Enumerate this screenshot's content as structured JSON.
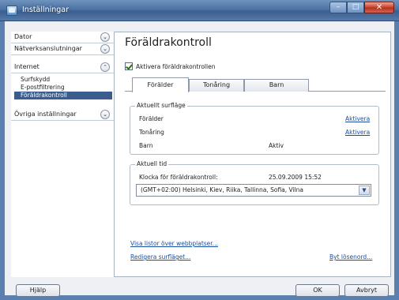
{
  "window": {
    "title": "Inställningar",
    "min": "–",
    "max": "□",
    "close": "✕"
  },
  "sidebar": {
    "categories": [
      {
        "label": "Dator",
        "chev": "⌄"
      },
      {
        "label": "Nätverksanslutningar",
        "chev": "⌄"
      },
      {
        "label": "Internet",
        "chev": "⌃"
      },
      {
        "label": "Övriga inställningar",
        "chev": "⌄"
      }
    ],
    "internet_items": [
      "Surfskydd",
      "E-postfiltrering",
      "Föräldrakontroll"
    ]
  },
  "main": {
    "heading": "Föräldrakontroll",
    "enable_label": "Aktivera föräldrakontrollen",
    "tabs": [
      "Förälder",
      "Tonåring",
      "Barn"
    ],
    "profile_group": {
      "legend": "Aktuellt surfläge",
      "rows": [
        {
          "label": "Förälder",
          "action": "Aktivera",
          "status": ""
        },
        {
          "label": "Tonåring",
          "action": "Aktivera",
          "status": ""
        },
        {
          "label": "Barn",
          "action": "",
          "status": "Aktiv"
        }
      ]
    },
    "time_group": {
      "legend": "Aktuell tid",
      "clock_label": "Klocka för föräldrakontroll:",
      "clock_value": "25.09.2009 15:52",
      "timezone": "(GMT+02:00) Helsinki, Kiev, Riika, Tallinna, Sofia, Vilna"
    },
    "links": {
      "show_lists": "Visa listor över webbplatser...",
      "edit_mode": "Redigera surfläget...",
      "change_password": "Byt lösenord..."
    }
  },
  "buttons": {
    "help": "Hjälp",
    "ok": "OK",
    "cancel": "Avbryt"
  }
}
